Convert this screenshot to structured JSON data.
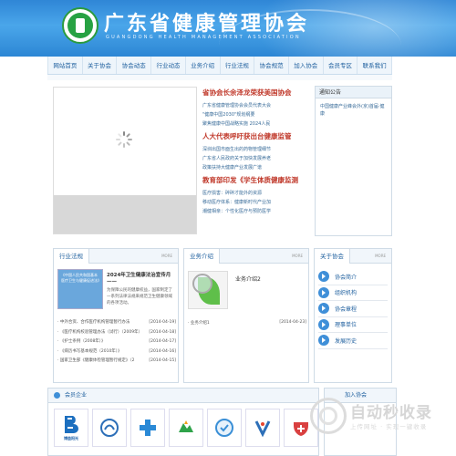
{
  "header": {
    "title": "广东省健康管理协会",
    "subtitle": "GUANGDONG HEALTH MANAGEMENT ASSOCIATION"
  },
  "nav": [
    "网站首页",
    "关于协会",
    "协会动态",
    "行业动态",
    "业务介绍",
    "行业法规",
    "协会规范",
    "加入协会",
    "会员专区",
    "联系我们"
  ],
  "news": [
    {
      "headline": "省协会长余泽龙荣获美国协会",
      "items": [
        "广东省健康管理协会会员代表大会",
        "\"健康中国2030\"规划纲要",
        "聚焦健康中国战略实施 2024人民"
      ]
    },
    {
      "headline": "人大代表呼吁获出台健康监管",
      "items": [
        "深圳出国市面生出的药物管理细节",
        "广东省人民政府关于加快发展养老",
        "政策扶持大健康产业发展广谱"
      ]
    },
    {
      "headline": "教育部印发《学生体质健康监测",
      "items": [
        "医疗损害：碎碎才能外的资源",
        "移动医疗体系：健康新时代产业加",
        "潮健相亲：个性化医疗与预防医学"
      ]
    }
  ],
  "notice": {
    "title": "通知公告",
    "items": [
      "中国健康产业峰会外(京)首届·健康"
    ]
  },
  "panel1": {
    "title": "行业法规",
    "more": "MORE",
    "thumb_text": "《中国人民共和国基本医疗卫生与健康促进法》",
    "feature_title": "2024年卫生健康法治宣传月——",
    "feature_text": "为保障公民的健康权益，国家制定了一系列法律法规来规范卫生健康领域的各项活动。",
    "list": [
      {
        "text": "· 中外合资、合作医疗机构管理暂行办法",
        "date": "[2014-04-19]"
      },
      {
        "text": "· 《医疗机构校验管理办法（试行）（2009年）",
        "date": "[2014-04-18]"
      },
      {
        "text": "· 《护士条例（2008年）》",
        "date": "[2014-04-17]"
      },
      {
        "text": "· 《病历书写基本规范（2010年）》",
        "date": "[2014-04-16]"
      },
      {
        "text": "· 国家卫生部《健康体检管理暂行规定》（2",
        "date": "[2014-04-15]"
      }
    ]
  },
  "panel2": {
    "title": "业务介绍",
    "more": "MORE",
    "feature_title": "业务介绍2",
    "list": [
      {
        "text": "· 业务介绍1",
        "date": "[2014-04-23]"
      }
    ]
  },
  "panel3": {
    "title": "关于协会",
    "more": "MORE",
    "menu": [
      "协会简介",
      "组织机构",
      "协会章程",
      "理事单位",
      "发展历史"
    ]
  },
  "members": {
    "title": "会员企业",
    "logos": [
      "博益阳光",
      "",
      "",
      "",
      "",
      "",
      ""
    ]
  },
  "join": {
    "title": "加入协会"
  },
  "watermark": {
    "big": "自动秒收录",
    "small": "上传网址 · 实现一键收录"
  }
}
